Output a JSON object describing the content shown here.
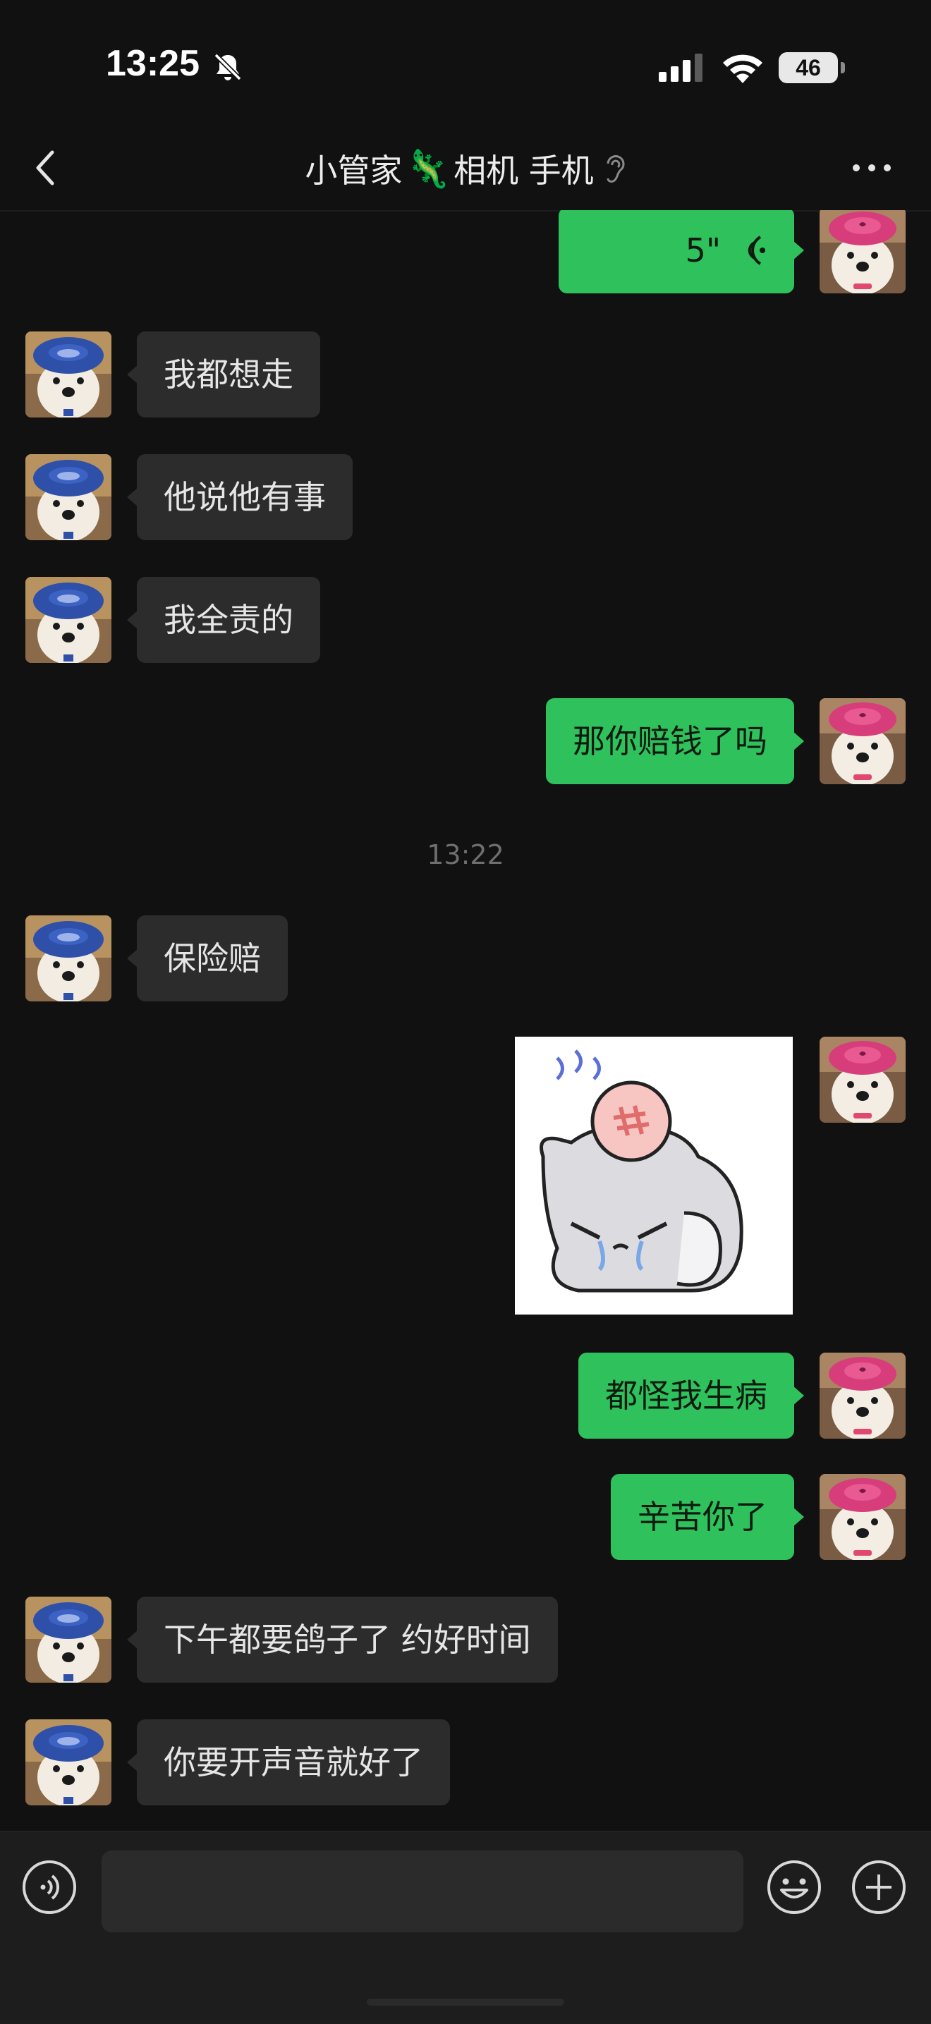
{
  "status_bar": {
    "time": "13:25",
    "battery_level": "46",
    "icons": [
      "bell-off-icon",
      "signal-icon",
      "wifi-icon",
      "battery-icon"
    ]
  },
  "nav": {
    "title_text": "小管家",
    "title_emoji": "🦎",
    "title_suffix": "相机 手机",
    "icons": [
      "back-icon",
      "ear-icon",
      "more-icon"
    ]
  },
  "messages": [
    {
      "side": "out",
      "type": "voice",
      "duration": "5\""
    },
    {
      "side": "in",
      "text": "我都想走"
    },
    {
      "side": "in",
      "text": "他说他有事"
    },
    {
      "side": "in",
      "text": "我全责的"
    },
    {
      "side": "out",
      "text": "那你赔钱了吗"
    },
    {
      "type": "time",
      "text": "13:22"
    },
    {
      "side": "in",
      "text": "保险赔"
    },
    {
      "side": "out",
      "type": "sticker",
      "description_icon": "angry-cat-sticker"
    },
    {
      "side": "out",
      "text": "都怪我生病"
    },
    {
      "side": "out",
      "text": "辛苦你了"
    },
    {
      "side": "in",
      "text": "下午都要鸽子了 约好时间"
    },
    {
      "side": "in",
      "text": "你要开声音就好了"
    }
  ],
  "input_bar": {
    "placeholder": "",
    "icons": [
      "voice-input-icon",
      "emoji-icon",
      "plus-icon"
    ]
  },
  "colors": {
    "background": "#111111",
    "incoming_bubble": "#2c2c2c",
    "outgoing_bubble": "#2fc25c",
    "input_bar": "#1d1d1d"
  }
}
